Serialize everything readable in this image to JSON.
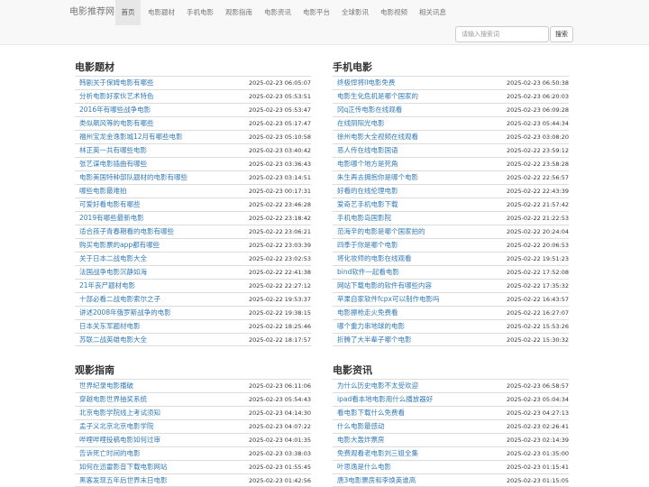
{
  "navbar": {
    "brand": "电影推荐网",
    "items": [
      {
        "label": "首页",
        "active": true
      },
      {
        "label": "电影题材",
        "active": false
      },
      {
        "label": "手机电影",
        "active": false
      },
      {
        "label": "观影指南",
        "active": false
      },
      {
        "label": "电影资讯",
        "active": false
      },
      {
        "label": "电影平台",
        "active": false
      },
      {
        "label": "全球影讯",
        "active": false
      },
      {
        "label": "电影视频",
        "active": false
      },
      {
        "label": "相关讯息",
        "active": false
      }
    ],
    "search_placeholder": "请输入搜索词",
    "search_button": "搜索"
  },
  "sections": [
    {
      "title": "电影题材",
      "items": [
        {
          "text": "韩剧关于保姆电影有哪些",
          "date": "2025-02-23 06:05:07"
        },
        {
          "text": "分析电影好家伙艺术特色",
          "date": "2025-02-23 05:53:51"
        },
        {
          "text": "2016年有哪些战争电影",
          "date": "2025-02-23 05:53:47"
        },
        {
          "text": "类似飙风等的电影有哪些",
          "date": "2025-02-23 05:17:47"
        },
        {
          "text": "福州宝龙金逸影城12月有哪些电影",
          "date": "2025-02-23 05:10:58"
        },
        {
          "text": "林正英一共有哪些电影",
          "date": "2025-02-23 03:40:42"
        },
        {
          "text": "张艺谋电影插曲有哪些",
          "date": "2025-02-23 03:36:43"
        },
        {
          "text": "电影美国特种部队题材的电影有哪些",
          "date": "2025-02-23 03:14:51"
        },
        {
          "text": "哪些电影最难拍",
          "date": "2025-02-23 00:17:31"
        },
        {
          "text": "可爱好看电影有哪些",
          "date": "2025-02-22 23:46:28"
        },
        {
          "text": "2019有哪些最新电影",
          "date": "2025-02-22 23:18:42"
        },
        {
          "text": "适合孩子青春期看的电影有哪些",
          "date": "2025-02-22 23:06:21"
        },
        {
          "text": "购买电影票的app都有哪些",
          "date": "2025-02-22 23:03:39"
        },
        {
          "text": "关于日本二战电影大全",
          "date": "2025-02-22 23:02:53"
        },
        {
          "text": "法国战争电影沉静如海",
          "date": "2025-02-22 22:41:38"
        },
        {
          "text": "21年丧尸题材电影",
          "date": "2025-02-22 22:27:12"
        },
        {
          "text": "十部必看二战电影索尔之子",
          "date": "2025-02-22 19:53:37"
        },
        {
          "text": "讲述2008年俄罗斯战争的电影",
          "date": "2025-02-22 19:38:15"
        },
        {
          "text": "日本关东军题材电影",
          "date": "2025-02-22 18:25:46"
        },
        {
          "text": "苏联二战英雄电影大全",
          "date": "2025-02-22 18:17:57"
        }
      ]
    },
    {
      "title": "手机电影",
      "items": [
        {
          "text": "终极悍将II电影免费",
          "date": "2025-02-23 06:50:38"
        },
        {
          "text": "电影生化危机是哪个国家的",
          "date": "2025-02-23 06:20:03"
        },
        {
          "text": "冈q正传电影在线观看",
          "date": "2025-02-23 06:09:28"
        },
        {
          "text": "在线阴阳光电影",
          "date": "2025-02-23 05:44:34"
        },
        {
          "text": "徐州电影大全视频在线观看",
          "date": "2025-02-23 03:08:20"
        },
        {
          "text": "恶人传在线电影国语",
          "date": "2025-02-22 23:59:12"
        },
        {
          "text": "电影哪个地方是死角",
          "date": "2025-02-22 23:58:28"
        },
        {
          "text": "朱生再去拥抱你是哪个电影",
          "date": "2025-02-22 22:56:57"
        },
        {
          "text": "好看的在线伦理电影",
          "date": "2025-02-22 22:43:39"
        },
        {
          "text": "爱奇艺手机电影下载",
          "date": "2025-02-22 21:57:42"
        },
        {
          "text": "手机电影岛国影院",
          "date": "2025-02-22 21:22:53"
        },
        {
          "text": "范海辛的电影是哪个国家拍的",
          "date": "2025-02-22 20:24:04"
        },
        {
          "text": "四季于你是哪个电影",
          "date": "2025-02-22 20:06:53"
        },
        {
          "text": "将化妆师的电影在线观看",
          "date": "2025-02-22 19:51:23"
        },
        {
          "text": "bind软件一起看电影",
          "date": "2025-02-22 17:52:08"
        },
        {
          "text": "网站下载电影的软件有哪些内容",
          "date": "2025-02-22 17:35:32"
        },
        {
          "text": "苹果自家软件fcpx可以制作电影吗",
          "date": "2025-02-22 16:43:57"
        },
        {
          "text": "电影擦枪走火免费看",
          "date": "2025-02-22 16:27:07"
        },
        {
          "text": "哪个重力串地球的电影",
          "date": "2025-02-22 15:53:26"
        },
        {
          "text": "折腾了大半辈子哪个电影",
          "date": "2025-02-22 15:30:32"
        }
      ]
    },
    {
      "title": "观影指南",
      "items": [
        {
          "text": "世界纪录电影播破",
          "date": "2025-02-23 06:11:06"
        },
        {
          "text": "穿越电影世界抽奖系统",
          "date": "2025-02-23 05:54:43"
        },
        {
          "text": "北京电影学院线上考试须知",
          "date": "2025-02-23 04:14:30"
        },
        {
          "text": "孟子义北京北京电影学院",
          "date": "2025-02-23 04:07:22"
        },
        {
          "text": "哔哩哔哩投稿电影如何过审",
          "date": "2025-02-23 04:01:35"
        },
        {
          "text": "告诉死亡时间的电影",
          "date": "2025-02-23 03:38:03"
        },
        {
          "text": "如何在迅雷影音下载电影网站",
          "date": "2025-02-23 01:55:45"
        },
        {
          "text": "黑客发现五年后世界末日电影",
          "date": "2025-02-23 01:42:56"
        }
      ]
    },
    {
      "title": "电影资讯",
      "items": [
        {
          "text": "为什么历史电影不太受欢迎",
          "date": "2025-02-23 06:58:57"
        },
        {
          "text": "ipad看本地电影用什么播放器好",
          "date": "2025-02-23 05:04:34"
        },
        {
          "text": "看电影下载什么免费看",
          "date": "2025-02-23 04:27:13"
        },
        {
          "text": "什么电影最感动",
          "date": "2025-02-23 02:26:41"
        },
        {
          "text": "电影大轰炸票房",
          "date": "2025-02-23 02:14:39"
        },
        {
          "text": "免费观看老电影刘三姐全集",
          "date": "2025-02-23 01:35:00"
        },
        {
          "text": "叶思逸是什么电影",
          "date": "2025-02-23 01:15:41"
        },
        {
          "text": "唐3电影票房和李焕英谁高",
          "date": "2025-02-23 01:15:05"
        }
      ]
    }
  ]
}
